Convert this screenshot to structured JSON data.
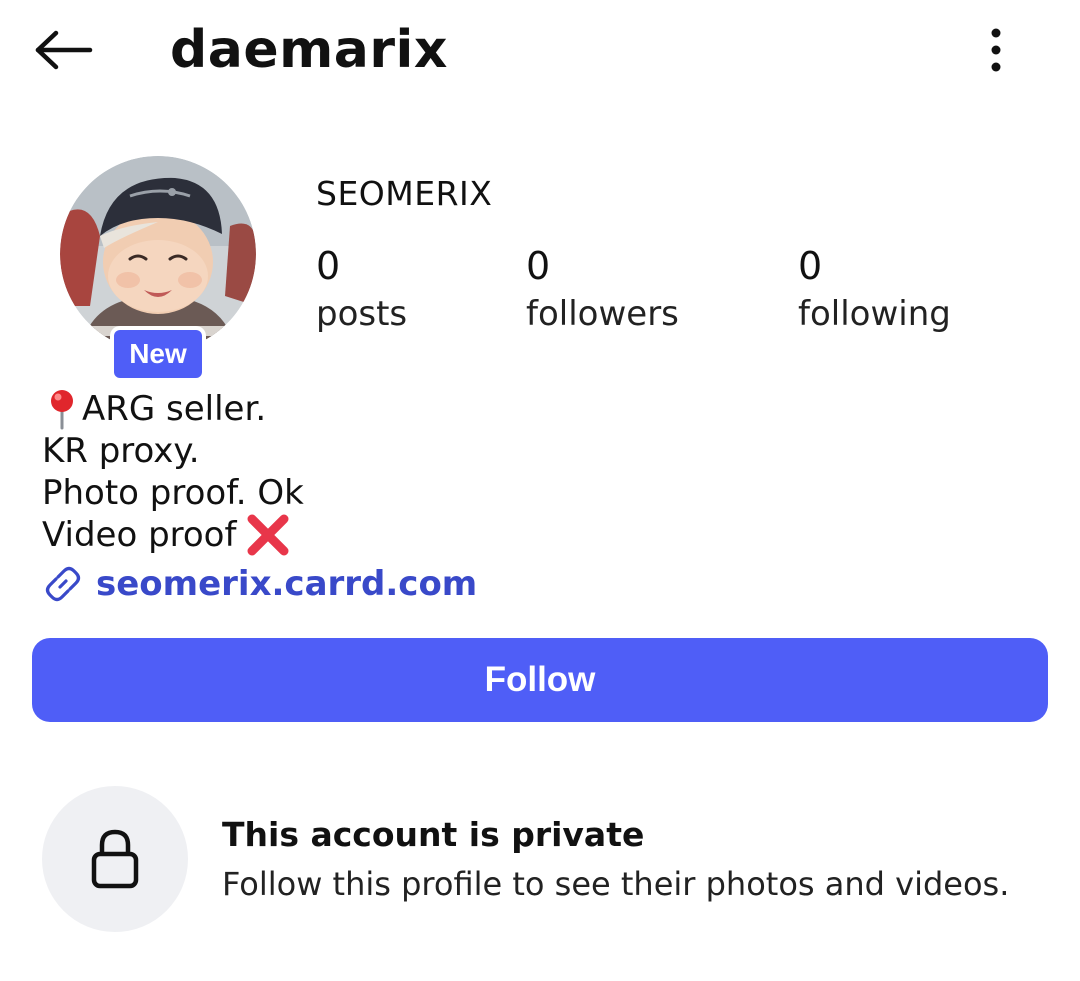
{
  "header": {
    "username": "daemarix",
    "back_icon": "arrow-left-icon",
    "more_icon": "more-vertical-icon"
  },
  "profile": {
    "display_name": "SEOMERIX",
    "badge": "New",
    "stats": [
      {
        "count": "0",
        "label": "posts"
      },
      {
        "count": "0",
        "label": "followers"
      },
      {
        "count": "0",
        "label": "following"
      }
    ],
    "bio_lines": [
      "ARG seller.",
      "KR proxy.",
      "Photo proof. Ok",
      "Video proof"
    ],
    "link": "seomerix.carrd.com"
  },
  "actions": {
    "follow_label": "Follow"
  },
  "private": {
    "title": "This account is private",
    "subtitle": "Follow this profile to see their photos and videos."
  },
  "colors": {
    "accent": "#4f5ef7",
    "link": "#3949c9",
    "lock_bg": "#eff0f3"
  }
}
